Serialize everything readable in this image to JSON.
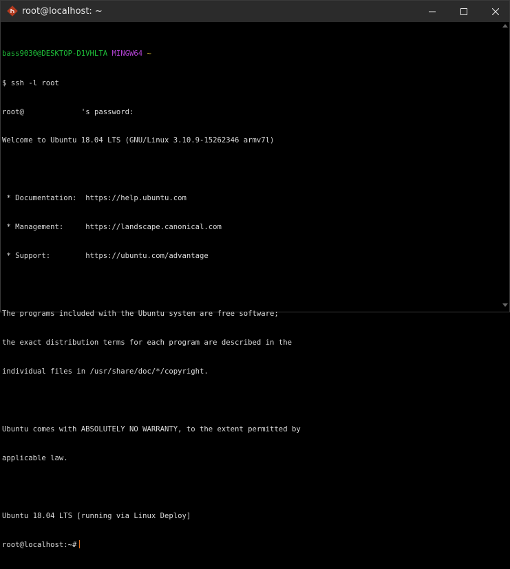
{
  "window": {
    "title": "root@localhost: ~",
    "icon": "git-bash-diamond-icon",
    "controls": {
      "minimize": "minimize-icon",
      "maximize": "maximize-icon",
      "close": "close-icon"
    }
  },
  "prompt": {
    "user_host": "bass9030@DESKTOP-D1VHLTA",
    "env": "MINGW64",
    "cwd": "~",
    "symbol": "$",
    "command": "ssh -l root"
  },
  "output": {
    "password_prefix": "root@",
    "password_suffix": "'s password:",
    "welcome": "Welcome to Ubuntu 18.04 LTS (GNU/Linux 3.10.9-15262346 armv7l)",
    "links": [
      {
        "label": " * Documentation:  ",
        "url": "https://help.ubuntu.com"
      },
      {
        "label": " * Management:     ",
        "url": "https://landscape.canonical.com"
      },
      {
        "label": " * Support:        ",
        "url": "https://ubuntu.com/advantage"
      }
    ],
    "license": [
      "The programs included with the Ubuntu system are free software;",
      "the exact distribution terms for each program are described in the",
      "individual files in /usr/share/doc/*/copyright."
    ],
    "warranty": [
      "Ubuntu comes with ABSOLUTELY NO WARRANTY, to the extent permitted by",
      "applicable law."
    ],
    "deploy": "Ubuntu 18.04 LTS [running via Linux Deploy]",
    "final_prompt": "root@localhost:~#"
  },
  "colors": {
    "prompt_user": "#1fc23a",
    "prompt_env": "#b544d6",
    "prompt_cwd": "#c8b12c",
    "cursor": "#e07020",
    "text": "#d9d9d9",
    "background": "#000000",
    "titlebar": "#2b2b2b"
  }
}
